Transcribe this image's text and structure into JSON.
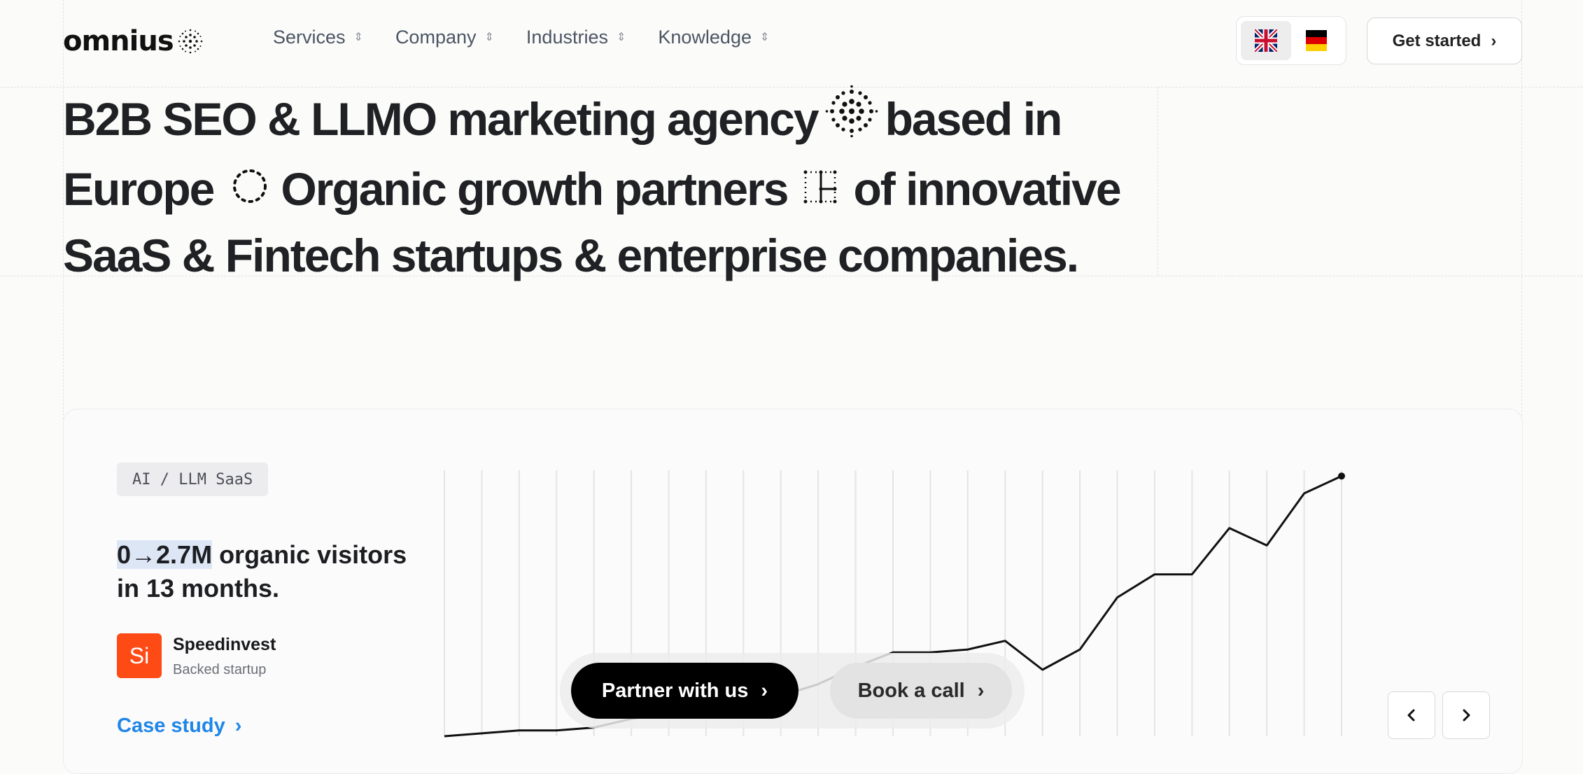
{
  "header": {
    "logo_text": "omnius",
    "nav": [
      {
        "label": "Services"
      },
      {
        "label": "Company"
      },
      {
        "label": "Industries"
      },
      {
        "label": "Knowledge"
      }
    ],
    "languages": [
      "English",
      "German"
    ],
    "cta_label": "Get started"
  },
  "hero": {
    "part1": "B2B SEO & LLMO marketing agency",
    "part2": "based in Europe",
    "part3": "Organic growth partners",
    "part4": "of innovative SaaS & Fintech startups & enterprise companies."
  },
  "case": {
    "tag": "AI / LLM SaaS",
    "stat_highlight": "0→2.7M",
    "stat_rest": " organic visitors in 13 months.",
    "brand_logo_text": "Si",
    "brand_name": "Speedinvest",
    "brand_sub": "Backed startup",
    "link_label": "Case study"
  },
  "chart_data": {
    "type": "line",
    "title": "",
    "xlabel": "",
    "ylabel": "",
    "x": [
      1,
      2,
      3,
      4,
      5,
      6,
      7,
      8,
      9,
      10,
      11,
      12,
      13,
      14,
      15,
      16,
      17,
      18,
      19,
      20,
      21,
      22,
      23,
      24,
      25
    ],
    "values": [
      0,
      1,
      2,
      2,
      3,
      6,
      8,
      9,
      13,
      14,
      18,
      24,
      29,
      29,
      30,
      33,
      23,
      30,
      48,
      56,
      56,
      72,
      66,
      84,
      90
    ],
    "ylim": [
      0,
      92
    ],
    "grid": "vertical"
  },
  "cta": {
    "primary": "Partner with us",
    "secondary": "Book a call"
  },
  "colors": {
    "accent_link": "#1f86e8",
    "brand_logo": "#fe4a15",
    "highlight": "#dde6f5"
  }
}
